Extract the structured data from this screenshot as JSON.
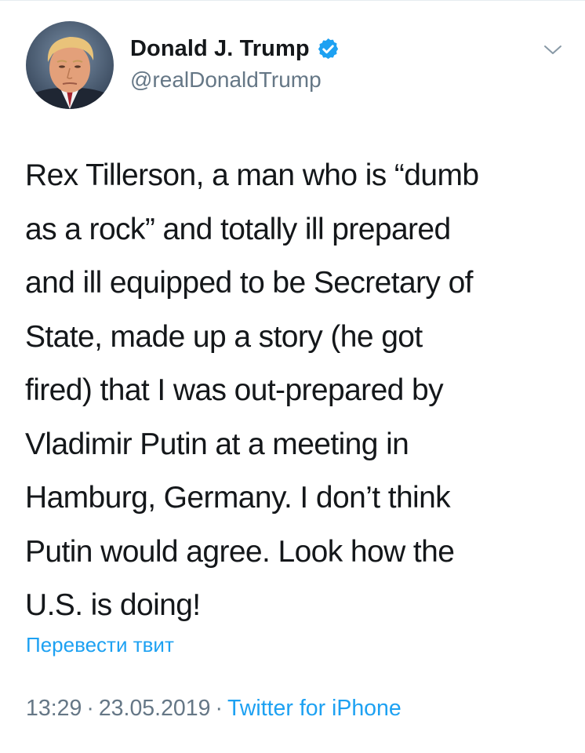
{
  "author": {
    "display_name": "Donald J. Trump",
    "handle": "@realDonaldTrump",
    "verified_icon": "verified-badge-icon",
    "avatar_icon": "profile-photo"
  },
  "tweet": {
    "text": "Rex Tillerson, a man who is “dumb\nas a rock” and totally ill prepared\nand ill equipped to be Secretary of\nState, made up a story (he got\nfired) that I was out-prepared by\nVladimir Putin at a meeting in\nHamburg, Germany. I don’t think\nPutin would agree. Look how the\nU.S. is doing!",
    "translate_label": "Перевести твит",
    "time": "13:29",
    "date": "23.05.2019",
    "separator": "·",
    "source": "Twitter for iPhone"
  },
  "colors": {
    "accent": "#1da1f2",
    "secondary_text": "#657786",
    "primary_text": "#14171a"
  },
  "menu": {
    "icon": "chevron-down-icon"
  }
}
